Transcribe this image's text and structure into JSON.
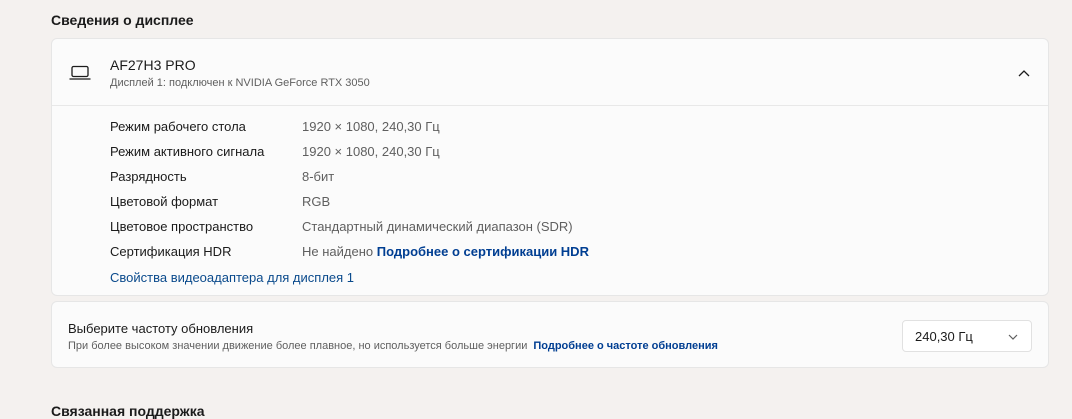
{
  "section_title": "Сведения о дисплее",
  "display": {
    "name": "AF27H3 PRO",
    "subtitle": "Дисплей 1: подключен к NVIDIA GeForce RTX 3050",
    "details": [
      {
        "label": "Режим рабочего стола",
        "value": "1920 × 1080, 240,30 Гц"
      },
      {
        "label": "Режим активного сигнала",
        "value": "1920 × 1080, 240,30 Гц"
      },
      {
        "label": "Разрядность",
        "value": "8-бит"
      },
      {
        "label": "Цветовой формат",
        "value": "RGB"
      },
      {
        "label": "Цветовое пространство",
        "value": "Стандартный динамический диапазон (SDR)"
      },
      {
        "label": "Сертификация HDR",
        "value": "Не найдено",
        "link": "Подробнее о сертификации HDR"
      }
    ],
    "adapter_link": "Свойства видеоадаптера для дисплея 1"
  },
  "refresh": {
    "title": "Выберите частоту обновления",
    "subtitle": "При более высоком значении движение более плавное, но используется больше энергии",
    "link": "Подробнее о частоте обновления",
    "selected": "240,30 Гц"
  },
  "bottom_title": "Связанная поддержка"
}
